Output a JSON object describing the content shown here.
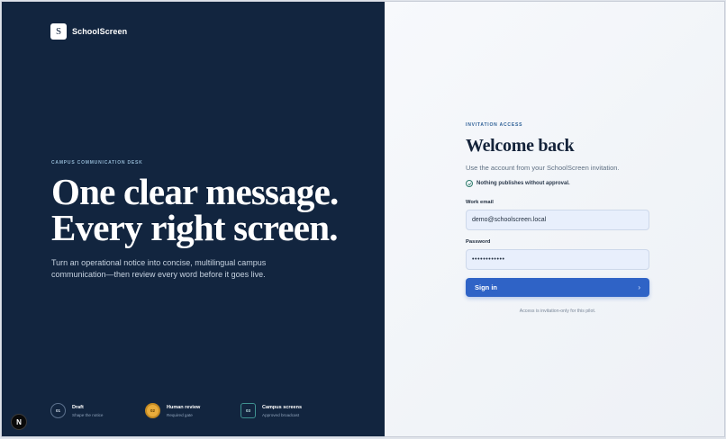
{
  "brand": {
    "mark": "S",
    "name": "SchoolScreen"
  },
  "left": {
    "eyebrow": "CAMPUS COMMUNICATION DESK",
    "headline_line1": "One clear message.",
    "headline_line2": "Every right screen.",
    "lede": "Turn an operational notice into concise, multilingual campus communication—then review every word before it goes live.",
    "steps": [
      {
        "number": "01",
        "title": "Draft",
        "subtitle": "Shape the notice"
      },
      {
        "number": "02",
        "title": "Human review",
        "subtitle": "Required gate"
      },
      {
        "number": "03",
        "title": "Campus screens",
        "subtitle": "Approved broadcast"
      }
    ],
    "fab_label": "N"
  },
  "form": {
    "eyebrow": "INVITATION ACCESS",
    "title": "Welcome back",
    "subtitle": "Use the account from your SchoolScreen invitation.",
    "assurance": "Nothing publishes without approval.",
    "email_label": "Work email",
    "email_value": "demo@schoolscreen.local",
    "password_label": "Password",
    "password_value": "••••••••••••",
    "signin_label": "Sign in",
    "footnote": "Access is invitation-only for this pilot."
  },
  "colors": {
    "left_panel": "#12253f",
    "accent_button": "#2f63c6",
    "active_step": "#e8ac3c"
  }
}
